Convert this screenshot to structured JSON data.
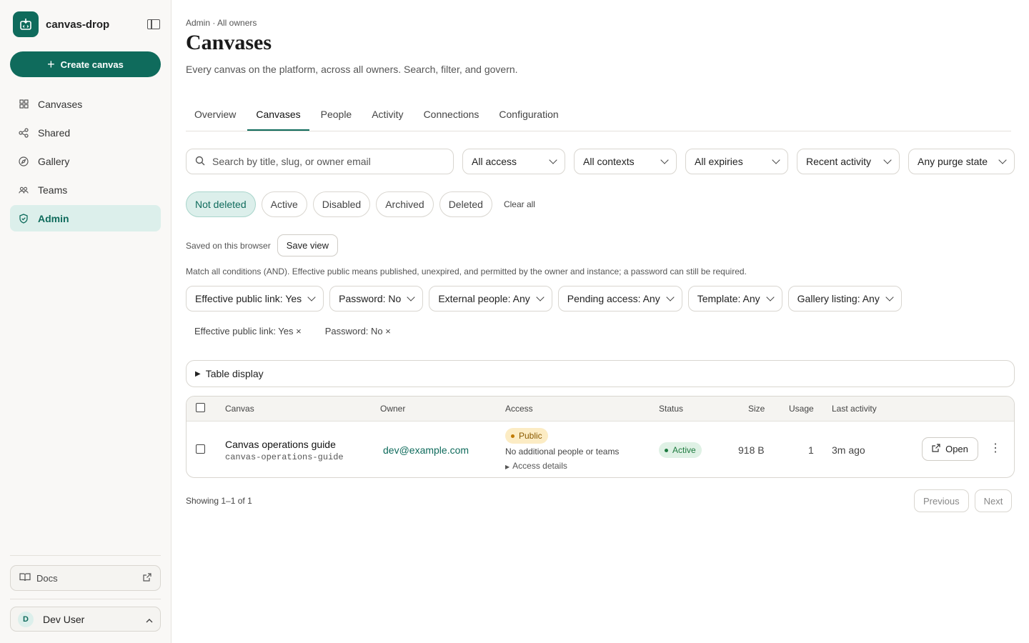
{
  "app": {
    "name": "canvas-drop"
  },
  "sidebar": {
    "create_label": "Create canvas",
    "items": [
      {
        "label": "Canvases",
        "icon": "grid-icon"
      },
      {
        "label": "Shared",
        "icon": "share-icon"
      },
      {
        "label": "Gallery",
        "icon": "compass-icon"
      },
      {
        "label": "Teams",
        "icon": "users-icon"
      },
      {
        "label": "Admin",
        "icon": "shield-icon",
        "active": true
      }
    ],
    "docs_label": "Docs",
    "user": {
      "initial": "D",
      "name": "Dev User"
    }
  },
  "header": {
    "breadcrumb": "Admin · All owners",
    "title": "Canvases",
    "subtitle": "Every canvas on the platform, across all owners. Search, filter, and govern."
  },
  "tabs": [
    {
      "label": "Overview"
    },
    {
      "label": "Canvases",
      "active": true
    },
    {
      "label": "People"
    },
    {
      "label": "Activity"
    },
    {
      "label": "Connections"
    },
    {
      "label": "Configuration"
    }
  ],
  "filters": {
    "search_placeholder": "Search by title, slug, or owner email",
    "selects": [
      "All access",
      "All contexts",
      "All expiries",
      "Recent activity",
      "Any purge state"
    ],
    "status_chips": [
      "Not deleted",
      "Active",
      "Disabled",
      "Archived",
      "Deleted"
    ],
    "active_chip": "Not deleted",
    "clear_all": "Clear all"
  },
  "saved": {
    "label": "Saved on this browser",
    "button": "Save view"
  },
  "match_text": "Match all conditions (AND). Effective public means published, unexpired, and permitted by the owner and instance; a password can still be required.",
  "advanced_filters": [
    "Effective public link: Yes",
    "Password: No",
    "External people: Any",
    "Pending access: Any",
    "Template: Any",
    "Gallery listing: Any"
  ],
  "active_pills": [
    "Effective public link: Yes ×",
    "Password: No ×"
  ],
  "table_display_label": "Table display",
  "table": {
    "columns": {
      "canvas": "Canvas",
      "owner": "Owner",
      "access": "Access",
      "status": "Status",
      "size": "Size",
      "usage": "Usage",
      "last": "Last activity"
    },
    "rows": [
      {
        "title": "Canvas operations guide",
        "slug": "canvas-operations-guide",
        "owner": "dev@example.com",
        "access_badge": "Public",
        "access_note": "No additional people or teams",
        "access_details": "Access details",
        "status": "Active",
        "size": "918 B",
        "usage": "1",
        "last_activity": "3m ago",
        "open_label": "Open"
      }
    ]
  },
  "pagination": {
    "showing": "Showing 1–1 of 1",
    "previous": "Previous",
    "next": "Next"
  },
  "colors": {
    "accent": "#0f6b5c",
    "public_badge": "#fcecc4",
    "active_badge": "#dff1e5"
  }
}
